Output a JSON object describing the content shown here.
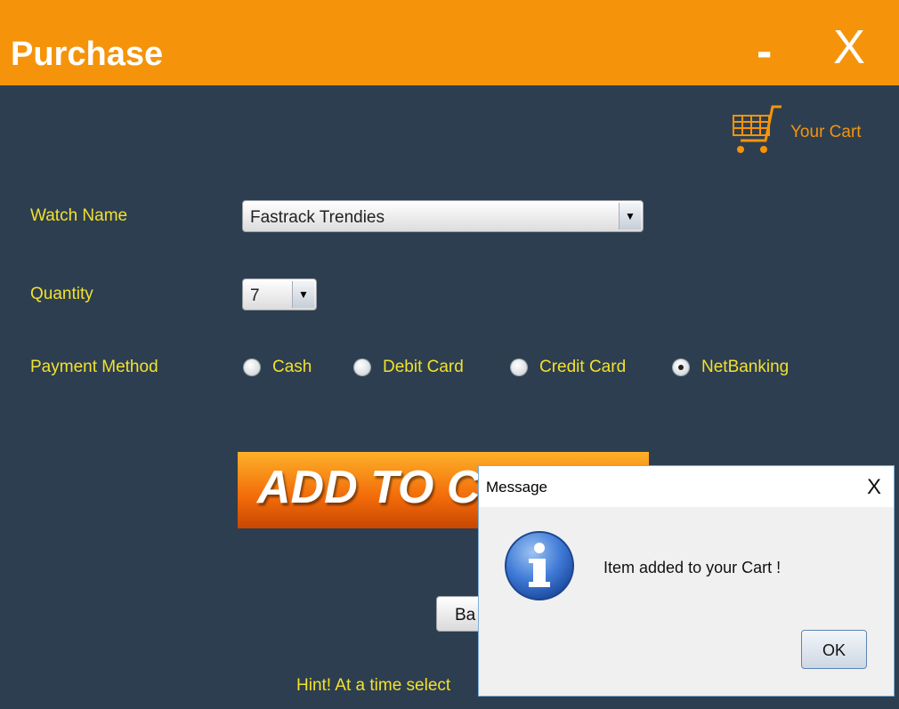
{
  "window": {
    "title": "Purchase",
    "minimize": "-",
    "close": "X"
  },
  "cart": {
    "label": "Your Cart"
  },
  "form": {
    "watch_label": "Watch Name",
    "watch_value": "Fastrack Trendies",
    "quantity_label": "Quantity",
    "quantity_value": "7",
    "payment_label": "Payment Method",
    "payment_options": [
      {
        "label": "Cash",
        "selected": false
      },
      {
        "label": "Debit Card",
        "selected": false
      },
      {
        "label": "Credit Card",
        "selected": false
      },
      {
        "label": "NetBanking",
        "selected": true
      }
    ]
  },
  "add_button": {
    "label": "ADD TO CA"
  },
  "back_button": {
    "label": "Ba"
  },
  "hint": "Hint! At a time select",
  "dialog": {
    "title": "Message",
    "close": "X",
    "message": "Item added to your Cart !",
    "ok": "OK"
  },
  "icons": {
    "cart": "shopping-cart-icon",
    "info": "info-icon",
    "arrow": "chevron-down-icon"
  }
}
